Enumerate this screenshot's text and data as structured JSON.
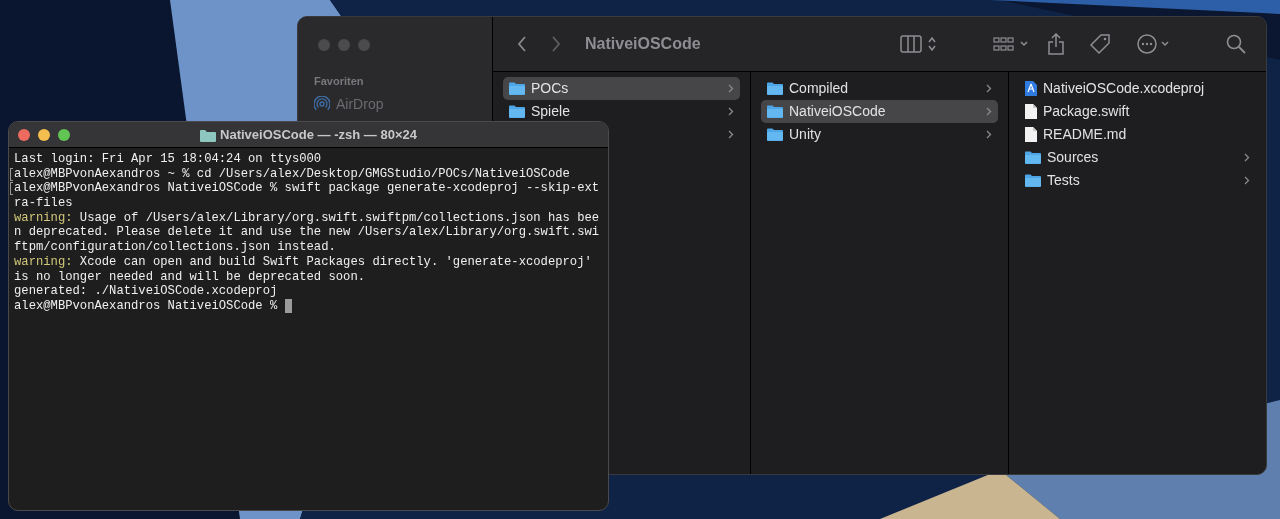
{
  "finder": {
    "title": "NativeiOSCode",
    "sidebar": {
      "heading": "Favoriten",
      "items": [
        {
          "label": "AirDrop",
          "kind": "airdrop"
        }
      ]
    },
    "columns": [
      {
        "items": [
          {
            "name": "POCs",
            "kind": "folder",
            "selected": true,
            "has_children": true
          },
          {
            "name": "Spiele",
            "kind": "folder",
            "selected": false,
            "has_children": true
          },
          {
            "selected": false,
            "has_children": true
          }
        ]
      },
      {
        "items": [
          {
            "name": "Compiled",
            "kind": "folder",
            "selected": false,
            "has_children": true
          },
          {
            "name": "NativeiOSCode",
            "kind": "folder",
            "selected": true,
            "has_children": true
          },
          {
            "name": "Unity",
            "kind": "folder",
            "selected": false,
            "has_children": true
          }
        ]
      },
      {
        "items": [
          {
            "name": "NativeiOSCode.xcodeproj",
            "kind": "project",
            "selected": false,
            "has_children": false
          },
          {
            "name": "Package.swift",
            "kind": "file",
            "selected": false,
            "has_children": false
          },
          {
            "name": "README.md",
            "kind": "file",
            "selected": false,
            "has_children": false
          },
          {
            "name": "Sources",
            "kind": "folder",
            "selected": false,
            "has_children": true
          },
          {
            "name": "Tests",
            "kind": "folder",
            "selected": false,
            "has_children": true
          }
        ]
      }
    ]
  },
  "terminal": {
    "title": "NativeiOSCode — -zsh — 80×24",
    "lines": [
      {
        "text": "Last login: Fri Apr 15 18:04:24 on ttys000",
        "marked": false
      },
      {
        "text": "alex@MBPvonAexandros ~ % cd /Users/alex/Desktop/GMGStudio/POCs/NativeiOSCode",
        "marked": true
      },
      {
        "text": "alex@MBPvonAexandros NativeiOSCode % swift package generate-xcodeproj --skip-ext",
        "marked": true
      },
      {
        "text": "ra-files",
        "marked": false
      },
      {
        "label": "warning:",
        "text": " Usage of /Users/alex/Library/org.swift.swiftpm/collections.json has bee",
        "marked": false
      },
      {
        "text": "n deprecated. Please delete it and use the new /Users/alex/Library/org.swift.swi",
        "marked": false
      },
      {
        "text": "ftpm/configuration/collections.json instead.",
        "marked": false
      },
      {
        "label": "warning:",
        "text": " Xcode can open and build Swift Packages directly. 'generate-xcodeproj'",
        "marked": false
      },
      {
        "text": "is no longer needed and will be deprecated soon.",
        "marked": false
      },
      {
        "text": "generated: ./NativeiOSCode.xcodeproj",
        "marked": false
      },
      {
        "text": "alex@MBPvonAexandros NativeiOSCode % ",
        "marked": false,
        "cursor": true
      }
    ]
  }
}
